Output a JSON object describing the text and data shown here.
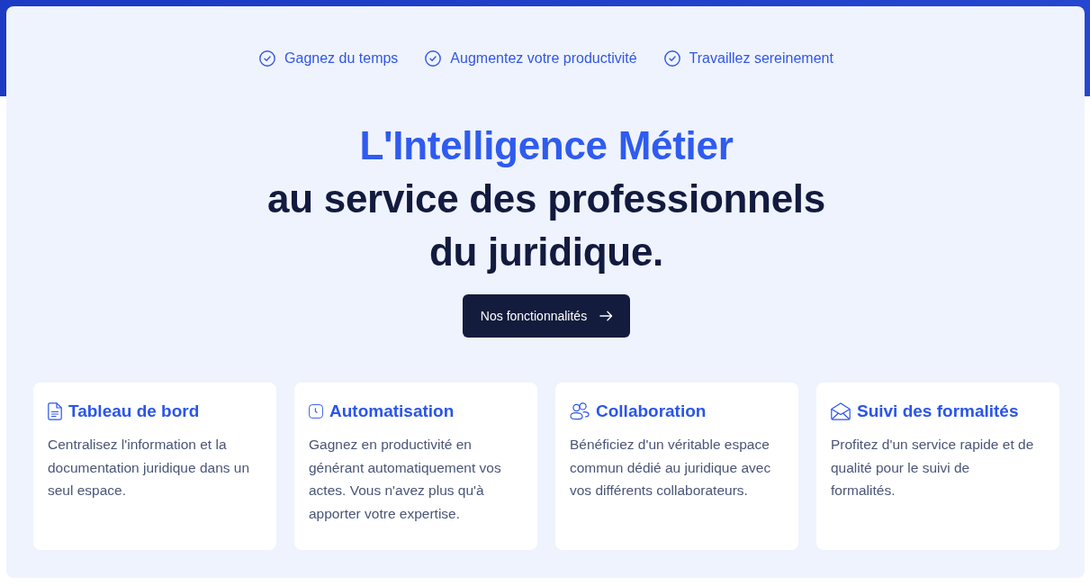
{
  "benefits": [
    "Gagnez du temps",
    "Augmentez votre productivité",
    "Travaillez sereinement"
  ],
  "hero": {
    "highlight": "L'Intelligence Métier",
    "lines": [
      "au service des professionnels",
      "du juridique."
    ]
  },
  "cta_button": {
    "label": "Nos fonctionnalités"
  },
  "features": [
    {
      "title": "Tableau de bord",
      "description": "Centralisez l'information et la documentation juridique dans un seul espace."
    },
    {
      "title": "Automatisation",
      "description": "Gagnez en productivité en générant automatiquement vos actes. Vous n'avez plus qu'à apporter votre expertise."
    },
    {
      "title": "Collaboration",
      "description": "Bénéficiez d'un véritable espace commun dédié au juridique avec vos différents collaborateurs."
    },
    {
      "title": "Suivi des formalités",
      "description": "Profitez d'un service rapide et de qualité pour le suivi de formalités."
    }
  ]
}
